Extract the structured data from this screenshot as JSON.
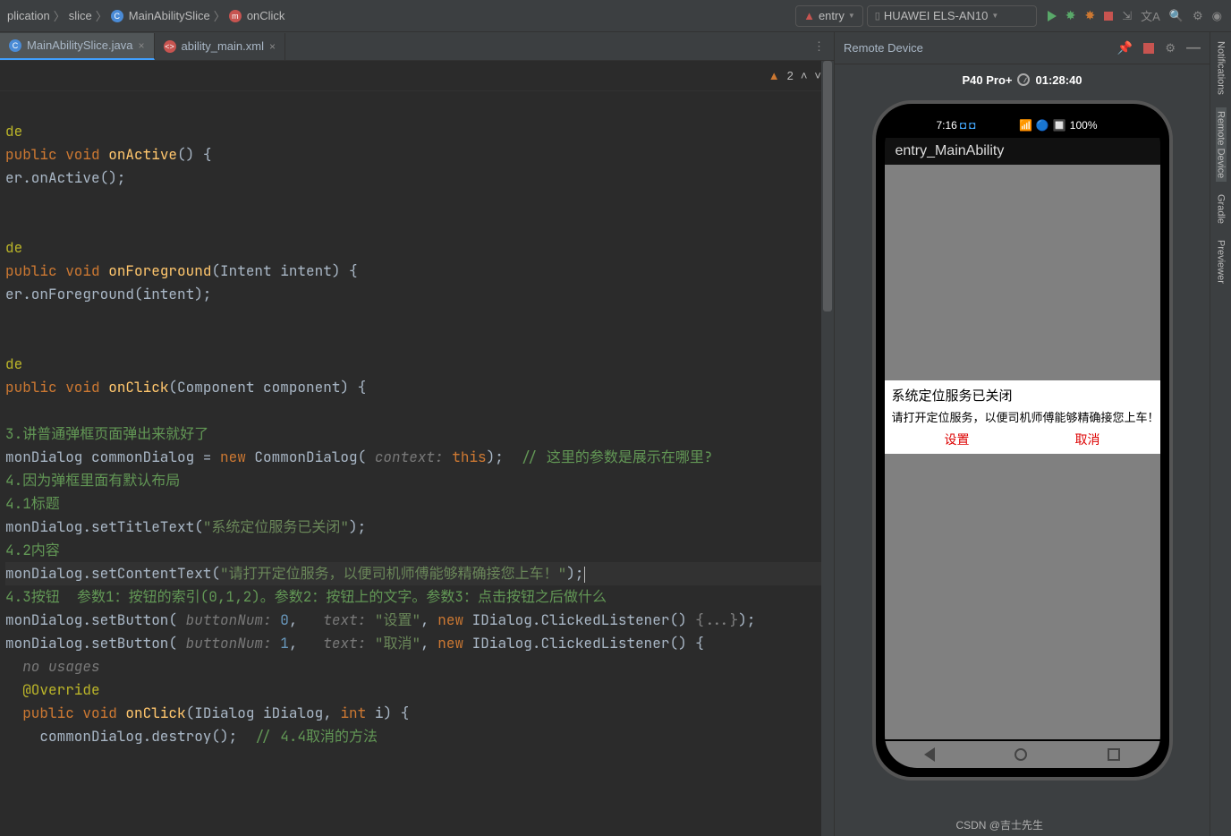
{
  "breadcrumb": {
    "p0": "plication",
    "p1": "slice",
    "p2": "MainAbilitySlice",
    "p3": "onClick"
  },
  "runconfig": {
    "entry": "entry",
    "device": "HUAWEI ELS-AN10"
  },
  "tabs": {
    "t1": "MainAbilitySlice.java",
    "t2": "ability_main.xml"
  },
  "editor": {
    "warn_count": "2"
  },
  "code": {
    "de": "de",
    "pub_void": "public void",
    "onActive": "onActive",
    "er": "er",
    "l2": ".onActive();",
    "onForeground": "onForeground",
    "l5_args": "(Intent intent) {",
    "l6": ".onForeground(intent);",
    "onClick": "onClick",
    "l8_args": "(Component component) {",
    "c3": "3.讲普通弹框页面弹出来就好了",
    "l9a": "monDialog commonDialog = ",
    "new": "new",
    "l9b": " CommonDialog(",
    "hint_ctx": " context: ",
    "this": "this",
    "l9c": ");",
    "c9": "// 这里的参数是展示在哪里?",
    "c4": "4.因为弹框里面有默认布局",
    "c41": "4.1标题",
    "l10a": "monDialog.setTitleText(",
    "s10": "\"系统定位服务已关闭\"",
    "l10b": ");",
    "c42": "4.2内容",
    "l11a": "monDialog.setContentText(",
    "s11": "\"请打开定位服务，以便司机师傅能够精确接您上车！\"",
    "l11b": ");",
    "c43": "4.3按钮  参数1：按钮的索引(0,1,2)。参数2：按钮上的文字。参数3：点击按钮之后做什么",
    "l12a": "monDialog.setButton(",
    "hint_bn": " buttonNum: ",
    "n0": "0",
    "l12b": ",  ",
    "hint_tx": " text: ",
    "s12": "\"设置\"",
    "l12c": ", ",
    "l12d": " IDialog.ClickedListener() ",
    "fold": "{...}",
    "l12e": ");",
    "n1": "1",
    "s13": "\"取消\"",
    "l13e": " IDialog.ClickedListener() {",
    "usages": "no usages",
    "ovr": "@Override",
    "l14": "(IDialog iDialog, ",
    "int": "int",
    "l14b": " i) {",
    "l15": "commonDialog.destroy();  ",
    "c44": "// 4.4取消的方法"
  },
  "remote": {
    "title": "Remote Device",
    "phone_name": "P40 Pro+",
    "timer": "01:28:40",
    "clock": "7:16",
    "battery": "100%",
    "app_title": "entry_MainAbility",
    "dialog_title": "系统定位服务已关闭",
    "dialog_text": "请打开定位服务，以便司机师傅能够精确接您上车！",
    "btn_set": "设置",
    "btn_cancel": "取消"
  },
  "dock": {
    "d1": "Notifications",
    "d2": "Remote Device",
    "d3": "Gradle",
    "d4": "Previewer"
  },
  "watermark": "CSDN @吉士先生"
}
